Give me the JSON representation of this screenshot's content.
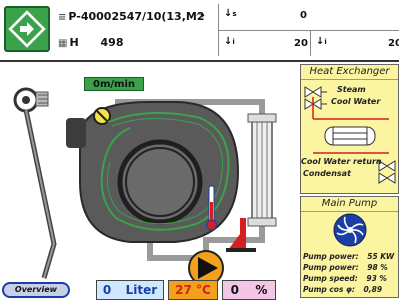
{
  "header": {
    "job_id": "P-40002547/10(13,M2",
    "h_label": "H",
    "h_value": "498",
    "s_label": "s",
    "s_value": "0",
    "i_label": "i",
    "i_value_1": "20",
    "i_value_2": "20"
  },
  "speed": {
    "value": "0m/min"
  },
  "heat_exchanger": {
    "title": "Heat Exchanger",
    "steam": "Steam",
    "cool_water": "Cool Water",
    "cool_water_return": "Cool Water return",
    "condensat": "Condensat"
  },
  "main_pump": {
    "title": "Main Pump",
    "rows": [
      {
        "label": "Pump power:",
        "value": "55 KW"
      },
      {
        "label": "Pump power:",
        "value": "98 %"
      },
      {
        "label": "Pump speed:",
        "value": "93 %"
      },
      {
        "label": "Pump cos φ:",
        "value": "0,89"
      }
    ]
  },
  "bottom": {
    "overview": "Overview",
    "liter_value": "0",
    "liter_unit": "Liter",
    "temp": "27 °C",
    "percent_value": "0",
    "percent_unit": "%"
  },
  "colors": {
    "green": "#3aa24a",
    "yellow_panel": "#fbf4a0",
    "orange": "#f3a01c",
    "pipe_grey": "#9a9a9a",
    "machine_grey": "#5a5a5a"
  }
}
